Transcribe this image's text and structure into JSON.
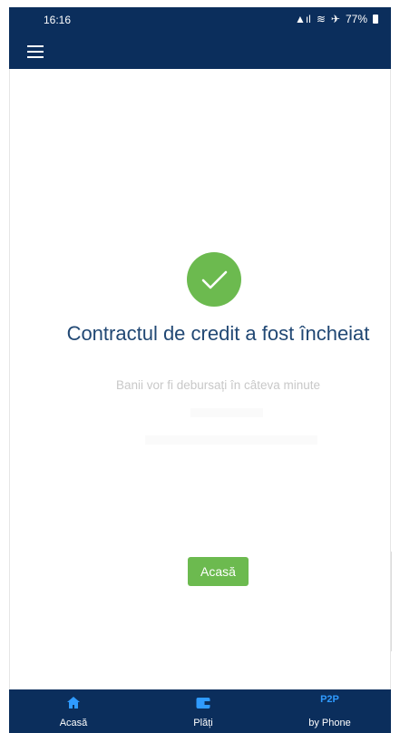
{
  "status_bar": {
    "time": "16:16",
    "signal": "▲ıl",
    "wifi": "≋",
    "airplane": "✈",
    "battery_level": "77%"
  },
  "header": {
    "menu_icon": "hamburger-icon"
  },
  "result": {
    "icon": "check-circle-icon",
    "title": "Contractul de credit a fost încheiat",
    "subtitle": "Banii vor fi debursați în câteva minute",
    "button_label": "Acasă"
  },
  "bottom_nav": {
    "items": [
      {
        "label": "Acasă",
        "icon": "home-icon"
      },
      {
        "label": "Plăți",
        "icon": "wallet-icon"
      },
      {
        "badge": "P2P",
        "label": "by Phone",
        "icon": "p2p-icon"
      }
    ]
  },
  "colors": {
    "navy": "#0b2e5c",
    "success_green": "#6cba4f",
    "title_blue": "#214874",
    "accent_blue": "#2f9bff"
  }
}
